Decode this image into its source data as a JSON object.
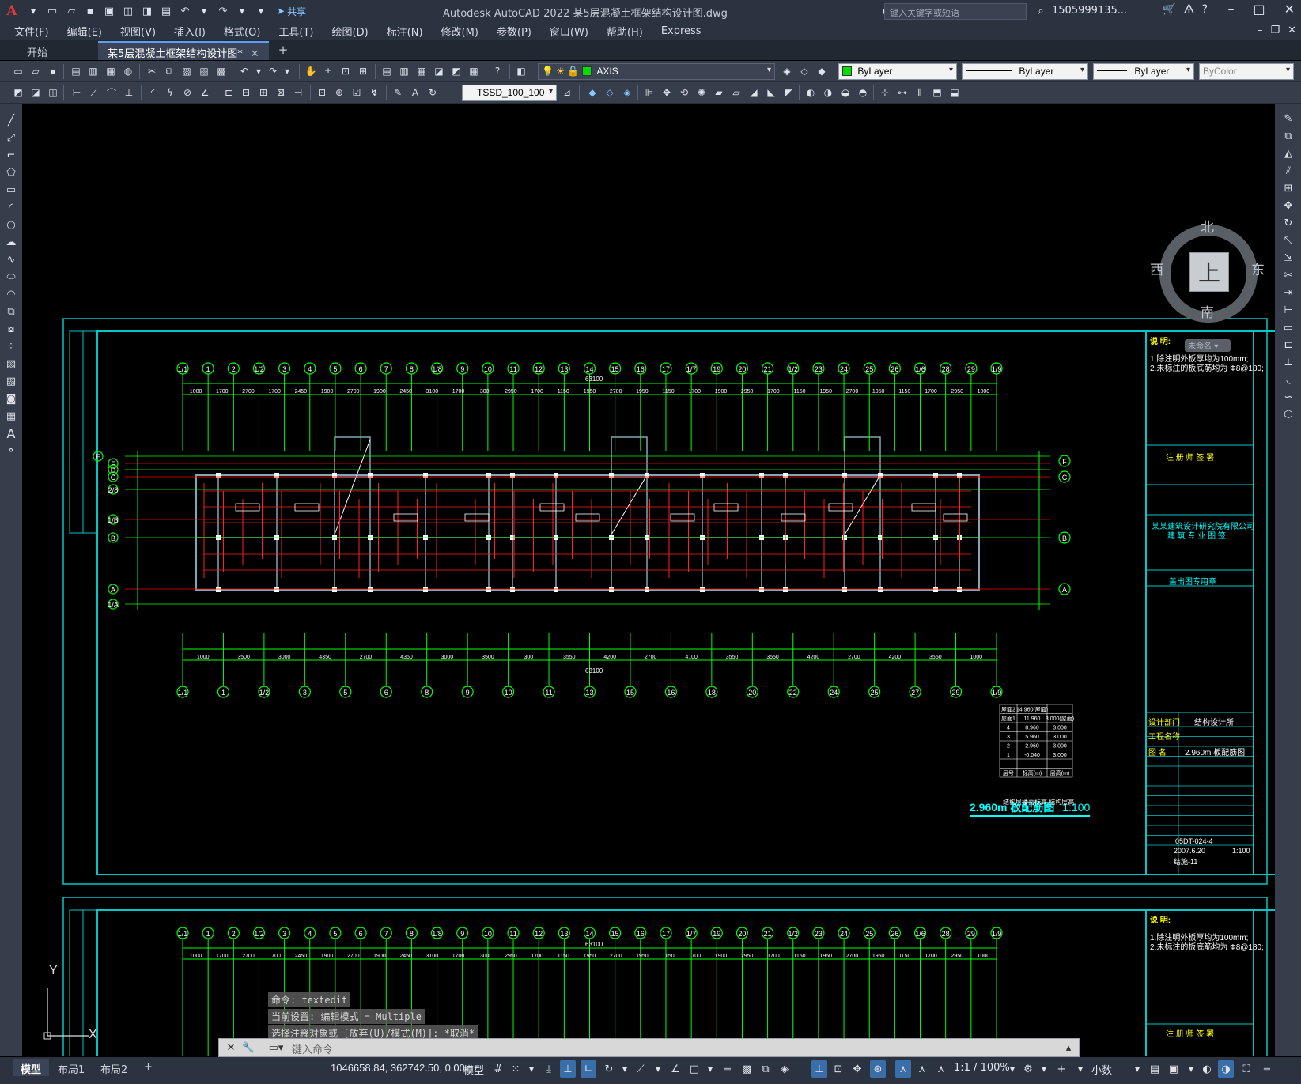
{
  "app": {
    "logo": "A",
    "title": "Autodesk AutoCAD 2022    某5层混凝土框架结构设计图.dwg",
    "share_label": "共享",
    "search_placeholder": "键入关键字或短语",
    "user": "1505999135...",
    "brand_color": "#e23a3a"
  },
  "menu": [
    "文件(F)",
    "编辑(E)",
    "视图(V)",
    "插入(I)",
    "格式(O)",
    "工具(T)",
    "绘图(D)",
    "标注(N)",
    "修改(M)",
    "参数(P)",
    "窗口(W)",
    "帮助(H)",
    "Express"
  ],
  "tabs": [
    {
      "label": "开始",
      "active": false
    },
    {
      "label": "某5层混凝土框架结构设计图*",
      "active": true
    }
  ],
  "toolbar": {
    "layer_combo": "AXIS",
    "layer_color": "#00e000",
    "color_combo": "ByLayer",
    "linetype_combo": "ByLayer",
    "lineweight_combo": "ByLayer",
    "plotstyle_combo": "ByColor",
    "dimstyle_combo": "TSSD_100_100"
  },
  "viewcube": {
    "north": "北",
    "south": "南",
    "west": "西",
    "east": "东",
    "top_face": "上",
    "ucs_name": "未命名"
  },
  "drawing": {
    "sheet1_title": "2.960m 板配筋图 1:100",
    "sheet1_title_main": "2.960m 板配筋图",
    "sheet1_scale": "1:100",
    "axis_top_labels": [
      "1/1",
      "1",
      "2",
      "1/2",
      "3",
      "4",
      "5",
      "6",
      "7",
      "8",
      "1/8",
      "9",
      "10",
      "11",
      "12",
      "13",
      "14",
      "15",
      "16",
      "17",
      "1/7",
      "19",
      "20",
      "21",
      "1/2",
      "23",
      "24",
      "25",
      "26",
      "1/6",
      "28",
      "29",
      "1/9"
    ],
    "axis_bottom_labels": [
      "1/1",
      "1",
      "1/2",
      "3",
      "5",
      "6",
      "8",
      "9",
      "10",
      "11",
      "13",
      "15",
      "16",
      "18",
      "20",
      "22",
      "24",
      "25",
      "27",
      "29",
      "1/9"
    ],
    "axis_left_labels": [
      "E",
      "F",
      "D",
      "C",
      "2/8",
      "1/B",
      "B",
      "A",
      "1/A"
    ],
    "axis_right_labels": [
      "F",
      "C",
      "B",
      "A"
    ],
    "top_dims": [
      "1000",
      "1700",
      "2700",
      "1700",
      "2450",
      "1900",
      "2700",
      "1900",
      "2450",
      "3100",
      "1700",
      "300",
      "2950",
      "1700",
      "1150",
      "1950",
      "2700",
      "1950",
      "1150",
      "1700",
      "1900",
      "2950",
      "1700",
      "1150",
      "1950",
      "2700",
      "1950",
      "1150",
      "1700",
      "2950",
      "1000"
    ],
    "top_total": "63100",
    "bottom_dims": [
      "1000",
      "3500",
      "3000",
      "4350",
      "2700",
      "4350",
      "3000",
      "3500",
      "300",
      "3550",
      "4200",
      "2700",
      "4100",
      "3550",
      "3550",
      "4200",
      "2700",
      "4200",
      "3550",
      "1000"
    ],
    "bottom_total": "63100",
    "notes_title": "说 明:",
    "notes": [
      "1.除注明外板厚均为100mm;",
      "2.未标注的板底筋均为 Ф8@180;"
    ],
    "title_block": {
      "header1": "注 册 师 签 署",
      "company": "某某建筑设计研究院有限公司",
      "header2": "建 筑 专 业 图 签",
      "header3": "盖出图专用章",
      "dept_label": "设计部门",
      "dept_value": "结构设计所",
      "project_label": "工程名称",
      "drawing_label": "图 名",
      "drawing_value": "2.960m 板配筋图",
      "number": "05DT-024-4",
      "date": "2007.6.20",
      "scale": "1:100",
      "sheet": "结施-11"
    },
    "level_table": {
      "rows": [
        [
          "屋面2",
          "14.960(屋面)",
          ""
        ],
        [
          "屋面1",
          "11.960",
          "3.000(屋面)"
        ],
        [
          "4",
          "8.960",
          "3.000"
        ],
        [
          "3",
          "5.960",
          "3.000"
        ],
        [
          "2",
          "2.960",
          "3.000"
        ],
        [
          "1",
          "-0.040",
          "3.000"
        ]
      ],
      "footer1": "层号",
      "footer2": "标高(m)",
      "footer3": "层高(m)",
      "caption": "结构层楼面标高 结构层高"
    }
  },
  "command": {
    "history": [
      "命令:  textedit",
      "当前设置: 编辑模式 = Multiple",
      "选择注释对象或 [放弃(U)/模式(M)]: *取消*"
    ],
    "placeholder": "键入命令"
  },
  "status": {
    "layouts": [
      {
        "label": "模型",
        "active": true
      },
      {
        "label": "布局1",
        "active": false
      },
      {
        "label": "布局2",
        "active": false
      }
    ],
    "coords": "1046658.84, 362742.50, 0.00",
    "model_label": "模型",
    "scale": "1:1 / 100%",
    "units": "小数"
  }
}
